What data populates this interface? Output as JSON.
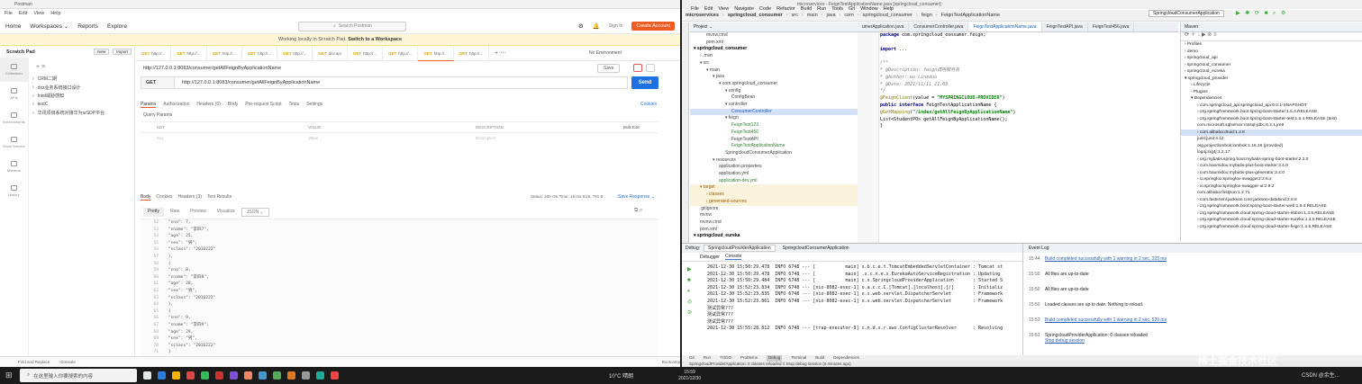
{
  "postman": {
    "window_title": "Postman",
    "menu": [
      "File",
      "Edit",
      "View",
      "Help"
    ],
    "header": {
      "home": "Home",
      "workspaces": "Workspaces ⌄",
      "reports": "Reports",
      "explore": "Explore",
      "search": "Search Postman",
      "signin": "Sign In",
      "create_account": "Create Account"
    },
    "banner": {
      "prefix": "Working locally in Scratch Pad.",
      "link": "Switch to a Workspace"
    },
    "sidebar": {
      "title": "Scratch Pad",
      "new": "New",
      "import": "Import",
      "rail": [
        "Collections",
        "APIs",
        "Environments",
        "Mock Servers",
        "Monitors",
        "History"
      ],
      "collections": [
        "CRM二期",
        "dxz业务系统接口设计",
        "Intel威胁感知",
        "testC",
        "华讯项目系统对接华为srSDP平台"
      ]
    },
    "tabs": [
      "http://...",
      "http://...",
      "http://...",
      "http://...",
      "http://...",
      "dev.api",
      "http://...",
      "http://...",
      "http://...",
      "http://..."
    ],
    "env": "No Environment",
    "request": {
      "name": "http://127.0.0.1:8083/consumer/getAllFeignByApplicationName",
      "save": "Save",
      "method": "GET",
      "url": "http://127.0.0.1:8083/consumer/getAllFeignByApplicationName",
      "send": "Send"
    },
    "req_tabs": [
      "Params",
      "Authorization",
      "Headers (6)",
      "Body",
      "Pre-request Script",
      "Tests",
      "Settings"
    ],
    "cookies": "Cookies",
    "query_params": "Query Params",
    "table_headers": [
      "KEY",
      "VALUE",
      "DESCRIPTION",
      "Bulk Edit"
    ],
    "table_placeholders": [
      "Key",
      "Value",
      "Description"
    ],
    "resp_tabs": [
      "Body",
      "Cookies",
      "Headers (3)",
      "Test Results"
    ],
    "status": "Status: 200 OK   Time: 15 ms   Size: 781 B",
    "save_response": "Save Response ⌄",
    "view_tabs": [
      "Pretty",
      "Raw",
      "Preview",
      "Visualize",
      "JSON ⌄"
    ],
    "code_lines": [
      {
        "n": "52",
        "t": "        \"sno\": 7,"
      },
      {
        "n": "53",
        "t": "        \"sname\": \"李四7\","
      },
      {
        "n": "54",
        "t": "        \"age\": 25,"
      },
      {
        "n": "55",
        "t": "        \"sex\": \"男\","
      },
      {
        "n": "56",
        "t": "        \"sclass\": \"2016222\""
      },
      {
        "n": "57",
        "t": "    },"
      },
      {
        "n": "58",
        "t": "    {"
      },
      {
        "n": "59",
        "t": "        \"sno\": 8,"
      },
      {
        "n": "60",
        "t": "        \"sname\": \"李四8\","
      },
      {
        "n": "61",
        "t": "        \"age\": 28,"
      },
      {
        "n": "62",
        "t": "        \"sex\": \"男\","
      },
      {
        "n": "63",
        "t": "        \"sclass\": \"2016222\""
      },
      {
        "n": "64",
        "t": "    },"
      },
      {
        "n": "65",
        "t": "    {"
      },
      {
        "n": "66",
        "t": "        \"sno\": 9,"
      },
      {
        "n": "67",
        "t": "        \"sname\": \"李四9\","
      },
      {
        "n": "68",
        "t": "        \"age\": 29,"
      },
      {
        "n": "69",
        "t": "        \"sex\": \"男\","
      },
      {
        "n": "70",
        "t": "        \"sclass\": \"2016222\""
      },
      {
        "n": "71",
        "t": "    }"
      },
      {
        "n": "72",
        "t": "]"
      }
    ],
    "bottom": [
      "Find and Replace",
      "Console",
      "Bootcamp"
    ]
  },
  "idea": {
    "window_title": "microservices - FeignTestApplicationName.java [springcloud_consumer]",
    "menu": [
      "File",
      "Edit",
      "View",
      "Navigate",
      "Code",
      "Refactor",
      "Build",
      "Run",
      "Tools",
      "Git",
      "Window",
      "Help"
    ],
    "breadcrumb": [
      "microservices",
      "springcloud_consumer",
      "src",
      "main",
      "java",
      "com",
      "springcloud_consumer",
      "feign",
      "FeignTestApplicationName"
    ],
    "run_config": "SpringcloudConsumerApplication",
    "project_label": "Project ⌄",
    "tree": [
      {
        "d": 2,
        "t": "mvnw.cmd",
        "c": "#444"
      },
      {
        "d": 2,
        "t": "pom.xml",
        "c": "#444"
      },
      {
        "d": 0,
        "t": "▾ springcloud_consumer",
        "c": "#000",
        "b": true
      },
      {
        "d": 1,
        "t": "› .mvn",
        "c": "#444"
      },
      {
        "d": 1,
        "t": "▾ src",
        "c": "#444"
      },
      {
        "d": 2,
        "t": "▾ main",
        "c": "#444"
      },
      {
        "d": 3,
        "t": "▾ java",
        "c": "#444"
      },
      {
        "d": 4,
        "t": "▾ com.springcloud_consumer",
        "c": "#444"
      },
      {
        "d": 5,
        "t": "▾ config",
        "c": "#444"
      },
      {
        "d": 6,
        "t": "ConfigBean",
        "c": "#444"
      },
      {
        "d": 5,
        "t": "▾ controller",
        "c": "#444"
      },
      {
        "d": 6,
        "t": "ConsumerController",
        "c": "#1f5fbf",
        "sel": true
      },
      {
        "d": 5,
        "t": "▾ feign",
        "c": "#444"
      },
      {
        "d": 6,
        "t": "FeignTest123",
        "c": "#2e7d32"
      },
      {
        "d": 6,
        "t": "FeignTest456",
        "c": "#2e7d32"
      },
      {
        "d": 6,
        "t": "FeignTestAPI",
        "c": "#444"
      },
      {
        "d": 6,
        "t": "FeignTestApplicationName",
        "c": "#2e7d32"
      },
      {
        "d": 5,
        "t": "SpringcloudConsumerApplication",
        "c": "#444"
      },
      {
        "d": 3,
        "t": "▾ resources",
        "c": "#444"
      },
      {
        "d": 4,
        "t": "application.properties",
        "c": "#444"
      },
      {
        "d": 4,
        "t": "application.yml",
        "c": "#444"
      },
      {
        "d": 4,
        "t": "application-dev.yml",
        "c": "#2e7d32"
      },
      {
        "d": 1,
        "t": "▾ target",
        "c": "#a35a00",
        "hl": true
      },
      {
        "d": 2,
        "t": "› classes",
        "c": "#a35a00",
        "hl": true
      },
      {
        "d": 2,
        "t": "› generated-sources",
        "c": "#a35a00",
        "hl": true
      },
      {
        "d": 1,
        "t": ".gitignore",
        "c": "#444"
      },
      {
        "d": 1,
        "t": "mvnw",
        "c": "#444"
      },
      {
        "d": 1,
        "t": "mvnw.cmd",
        "c": "#444"
      },
      {
        "d": 1,
        "t": "pom.xml",
        "c": "#444"
      },
      {
        "d": 0,
        "t": "▾ springcloud_eureka",
        "c": "#000",
        "b": true
      }
    ],
    "editor_tabs": [
      "umerApplication.java",
      "ConsumerController.java",
      "FeignTestApplicationName.java",
      "FeignTestAPI.java",
      "FeignTest456.java"
    ],
    "maven_title": "Maven",
    "maven": [
      {
        "d": 0,
        "t": "› Profiles"
      },
      {
        "d": 0,
        "t": "› demo"
      },
      {
        "d": 0,
        "t": "› springcloud_api"
      },
      {
        "d": 0,
        "t": "› springcloud_consumer"
      },
      {
        "d": 0,
        "t": "› springcloud_eureka"
      },
      {
        "d": 0,
        "t": "▾ springcloud_provider"
      },
      {
        "d": 1,
        "t": "› Lifecycle"
      },
      {
        "d": 1,
        "t": "› Plugins"
      },
      {
        "d": 1,
        "t": "▾ Dependencies"
      },
      {
        "d": 2,
        "t": "› com.springcloud_api:springcloud_api:0.0.1-SNAPSHOT"
      },
      {
        "d": 2,
        "t": "› org.springframework.boot:spring-boot-starter:1.5.4.RELEASE"
      },
      {
        "d": 2,
        "t": "› org.springframework.boot:spring-boot-starter-test:1.5.4.RELEASE (test)"
      },
      {
        "d": 2,
        "t": "  com.microsoft.sqlserver:mssql-jdbc:6.2.1.jre8"
      },
      {
        "d": 2,
        "t": "› com.alibaba:druid:1.2.6",
        "sel": true
      },
      {
        "d": 2,
        "t": "  junit:junit:4.12"
      },
      {
        "d": 2,
        "t": "  org.projectlombok:lombok:1.16.16 (provided)"
      },
      {
        "d": 2,
        "t": "  log4j:log4j:1.2.17"
      },
      {
        "d": 2,
        "t": "› org.mybatis.spring.boot:mybatis-spring-boot-starter:2.2.0"
      },
      {
        "d": 2,
        "t": "› com.baomidou:mybatis-plus-boot-starter:3.4.0"
      },
      {
        "d": 2,
        "t": "› com.baomidou:mybatis-plus-generator:3.4.0"
      },
      {
        "d": 2,
        "t": "› io.springfox:springfox-swagger2:2.9.2"
      },
      {
        "d": 2,
        "t": "› io.springfox:springfox-swagger-ui:2.9.2"
      },
      {
        "d": 2,
        "t": "  com.alibaba:fastjson:1.2.71"
      },
      {
        "d": 2,
        "t": "› com.fasterxml.jackson.core:jackson-databind:2.8.8"
      },
      {
        "d": 2,
        "t": "› org.springframework.boot:spring-boot-starter-web:1.5.4.RELEASE"
      },
      {
        "d": 2,
        "t": "› org.springframework.cloud:spring-cloud-starter-ribbon:1.3.5.RELEASE"
      },
      {
        "d": 2,
        "t": "› org.springframework.cloud:spring-cloud-starter-eureka:1.3.5.RELEASE"
      },
      {
        "d": 2,
        "t": "› org.springframework.cloud:spring-cloud-starter-feign:1.3.5.RELEASE"
      }
    ],
    "code": [
      [
        "kw",
        "package "
      ],
      [
        "",
        "com.springcloud_consumer.feign;"
      ],
      [
        "br"
      ],
      [
        "br"
      ],
      [
        "kw",
        "import "
      ],
      [
        "",
        "..."
      ],
      [
        "br"
      ],
      [
        "br"
      ],
      [
        "cm",
        "/**"
      ],
      [
        "br"
      ],
      [
        "cm",
        " * @Description: feign调用服务名"
      ],
      [
        "br"
      ],
      [
        "cm",
        " * @Author: wu Lineduo"
      ],
      [
        "br"
      ],
      [
        "cm",
        " * @Date: 2021/11/11 21:09"
      ],
      [
        "br"
      ],
      [
        "cm",
        " */"
      ],
      [
        "br"
      ],
      [
        "an",
        "@FeignClient"
      ],
      [
        "",
        "(value = "
      ],
      [
        "st",
        "\"MYSPRINGCLOUD-PROVIDER\""
      ],
      [
        "",
        ")"
      ],
      [
        "br"
      ],
      [
        "kw",
        "public interface "
      ],
      [
        "",
        "FeignTestApplicationName {"
      ],
      [
        "br"
      ],
      [
        "an",
        "    @GetMapping"
      ],
      [
        "",
        "("
      ],
      [
        "st",
        "\"/index/getAllFeignByApplicationName\""
      ],
      [
        "",
        ")"
      ],
      [
        "br"
      ],
      [
        "",
        "    List<StudentPO> getAllFeignByApplicationName();"
      ],
      [
        "br"
      ],
      [
        "",
        "}"
      ]
    ],
    "debug_label": "Debug:",
    "debug_tabs": [
      "SpringcloudProviderApplication",
      "SpringcloudConsumerApplication"
    ],
    "debugger_tabs": [
      "Debugger",
      "Console"
    ],
    "console": [
      "2021-12-30 15:50:29.478  INFO 6748 --- [           main] s.b.c.e.t.TomcatEmbeddedServletContainer : Tomcat st",
      "2021-12-30 15:50:29.478  INFO 6748 --- [           main] .s.c.n.e.s.EurekaAutoServiceRegistration : Updating",
      "2021-12-30 15:50:29.484  INFO 6748 --- [           main] c.s.SpringcloudProviderApplication       : Started S",
      "2021-12-30 15:52:23.834  INFO 6748 --- [nio-8082-exec-1] o.a.c.c.C.[Tomcat].[localhost].[/]       : Initializ",
      "2021-12-30 15:52:23.835  INFO 6748 --- [nio-8082-exec-1] o.s.web.servlet.DispatcherServlet        : Framework",
      "2021-12-30 15:52:23.861  INFO 6748 --- [nio-8082-exec-1] o.s.web.servlet.DispatcherServlet        : Framework",
      "测试异常???",
      "测试异常???",
      "测试异常???",
      "2021-12-30 15:55:28.812  INFO 6748 --- [trap-executor-0] c.n.d.s.r.aws.ConfigClusterResolver      : Resolving"
    ],
    "event_log_title": "Event Log",
    "events": [
      {
        "time": "15:44",
        "text": "Build completed successfully with 1 warning in 2 sec, 323 ms",
        "link": true
      },
      {
        "time": "15:50",
        "text": "All files are up-to-date",
        "link": false
      },
      {
        "time": "15:50",
        "text": "All files are up-to-date",
        "link": false
      },
      {
        "time": "15:50",
        "text": "Loaded classes are up to date. Nothing to reload.",
        "link": false
      },
      {
        "time": "15:53",
        "text": "Build completed successfully with 1 warning in 2 sec, 520 ms",
        "link": true
      },
      {
        "time": "15:53",
        "text": "SpringcloudProviderApplication: 0 classes reloaded",
        "link": false,
        "sub": "Stop debug session"
      }
    ],
    "bottom_tabs": [
      "Git",
      "Run",
      "TODO",
      "Problems",
      "Debug",
      "Terminal",
      "Build",
      "Dependencies"
    ],
    "status": "SpringcloudProviderApplication: 0 classes reloaded // Stop debug session (6 minutes ago)"
  },
  "taskbar": {
    "search": "在这里输入你要搜索的内容",
    "weather": "10°C 晴朗",
    "time": "15:59",
    "date": "2021/12/30",
    "watermark": "稀土掘金技术社区",
    "csdn": "CSDN @余生..."
  }
}
